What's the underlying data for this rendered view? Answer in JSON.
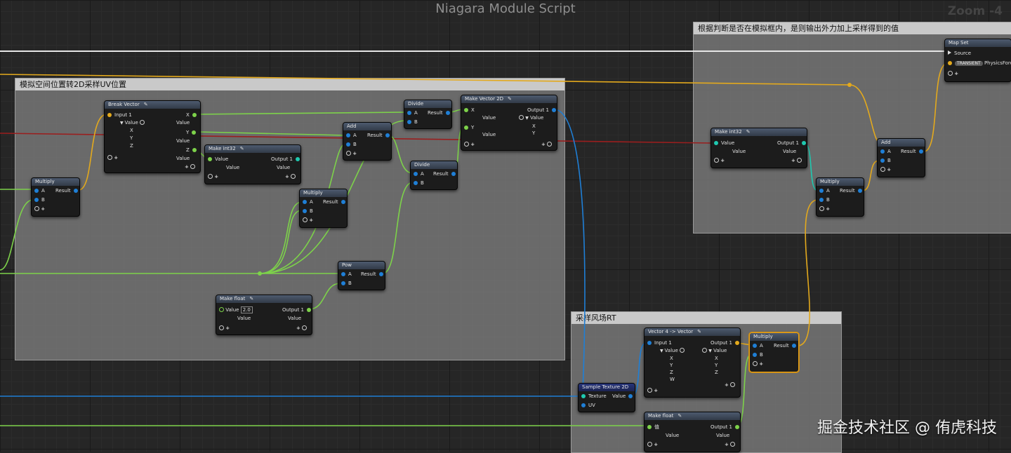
{
  "editor": {
    "title": "Niagara Module Script",
    "zoom": "Zoom -4"
  },
  "comments": {
    "uv": "模拟空间位置转2D采样UV位置",
    "external": "根据判断是否在模拟框内，是则输出外力加上采样得到的值",
    "rt": "采样风场RT"
  },
  "nodes": {
    "multiply1": {
      "title": "Multiply",
      "a": "A",
      "b": "B",
      "result": "Result"
    },
    "break_vector": {
      "title": "Break Vector",
      "input": "Input 1",
      "value": "Value",
      "x": "X",
      "y": "Y",
      "z": "Z"
    },
    "make_int_a": {
      "title": "Make int32",
      "value": "Value",
      "output": "Output 1"
    },
    "add1": {
      "title": "Add",
      "a": "A",
      "b": "B",
      "result": "Result"
    },
    "divide1": {
      "title": "Divide",
      "a": "A",
      "b": "B",
      "result": "Result"
    },
    "divide2": {
      "title": "Divide",
      "a": "A",
      "b": "B",
      "result": "Result"
    },
    "multiply2": {
      "title": "Multiply",
      "a": "A",
      "b": "B",
      "result": "Result"
    },
    "make_vector2d": {
      "title": "Make Vector 2D",
      "x": "X",
      "y": "Y",
      "output": "Output 1",
      "value": "Value"
    },
    "pow": {
      "title": "Pow",
      "a": "A",
      "b": "B",
      "result": "Result"
    },
    "make_float_a": {
      "title": "Make float",
      "value": "Value",
      "value_input": "2.0",
      "output": "Output 1"
    },
    "make_int_b": {
      "title": "Make int32",
      "value": "Value",
      "output": "Output 1"
    },
    "multiply3": {
      "title": "Multiply",
      "a": "A",
      "b": "B",
      "result": "Result"
    },
    "add2": {
      "title": "Add",
      "a": "A",
      "b": "B",
      "result": "Result"
    },
    "map_set": {
      "title": "Map Set",
      "source": "Source",
      "badge": "TRANSIENT",
      "force": "PhysicsForce"
    },
    "vec4_to_vec": {
      "title": "Vector 4 -> Vector",
      "input": "Input 1",
      "output": "Output 1",
      "value": "Value",
      "x": "X",
      "y": "Y",
      "z": "Z",
      "w": "W"
    },
    "multiply4": {
      "title": "Multiply",
      "a": "A",
      "b": "B",
      "result": "Result"
    },
    "sample_tex": {
      "title": "Sample Texture 2D",
      "texture": "Texture",
      "uv": "UV",
      "value": "Value"
    },
    "make_float_b": {
      "title": "Make float",
      "value": "值",
      "output": "Output 1",
      "value_label": "Value"
    }
  },
  "colors": {
    "float": "#7dd24a",
    "vector": "#1f7fd6",
    "int": "#1fc9b0",
    "param": "#e3a91d"
  },
  "watermark": "掘金技术社区 @ 侑虎科技"
}
